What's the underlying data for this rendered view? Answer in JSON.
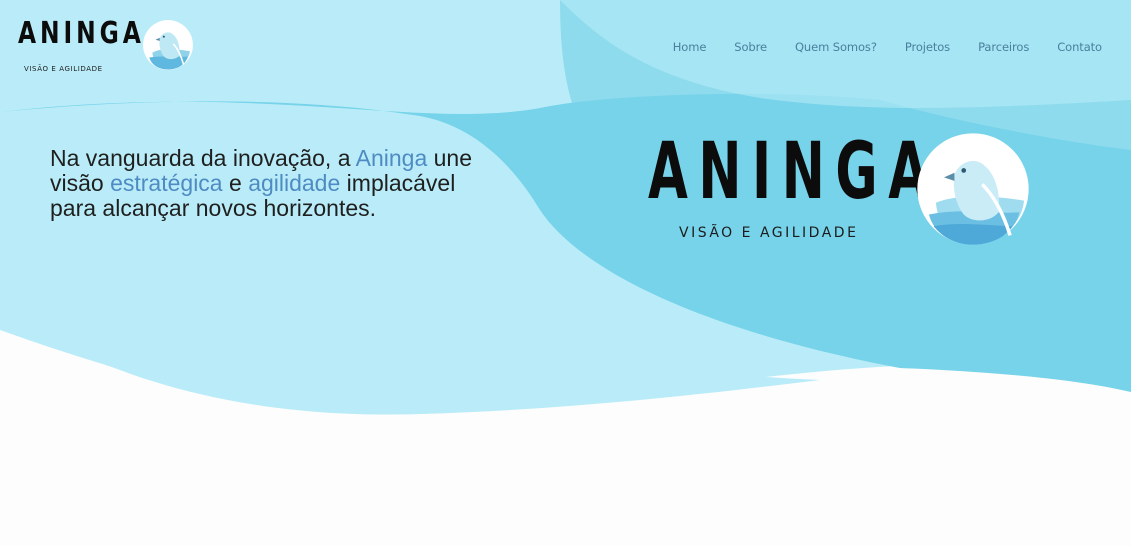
{
  "brand": {
    "name": "ANINGA",
    "tagline": "VISÃO E AGILIDADE"
  },
  "nav": {
    "items": [
      "Home",
      "Sobre",
      "Quem Somos?",
      "Projetos",
      "Parceiros",
      "Contato"
    ]
  },
  "hero": {
    "headline": {
      "p1": "Na vanguarda da inovação, a ",
      "h1": "Aninga",
      "p2": " une visão ",
      "h2": "estratégica",
      "p3": " e ",
      "h3": "agilidade",
      "p4": " implacável para alcançar novos horizontes."
    },
    "logo_name": "ANINGA",
    "logo_tagline": "VISÃO E AGILIDADE"
  },
  "colors": {
    "wave_light": "#b9ecf8",
    "wave_mid": "#8fdbee",
    "wave_deep": "#69cfe6",
    "accent_text": "#4f8bc3",
    "nav_text": "#4a7f9e"
  },
  "icons": {
    "bird": "bird-logo-icon"
  }
}
